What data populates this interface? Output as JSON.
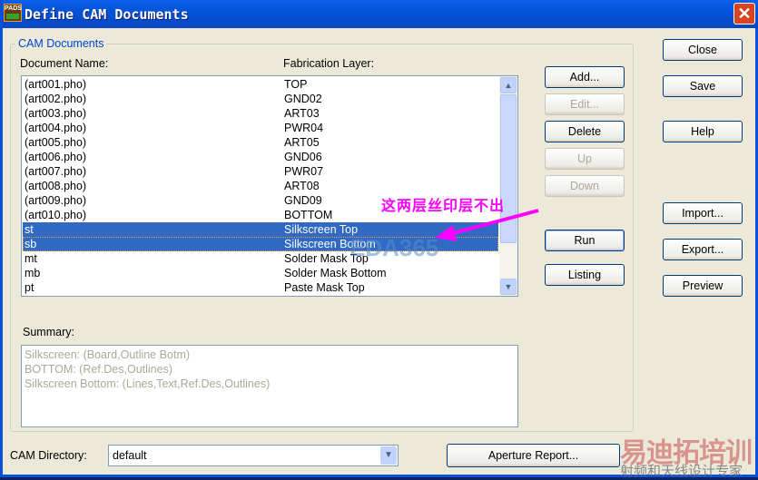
{
  "window": {
    "title": "Define CAM Documents",
    "icon_text": "PADS"
  },
  "group": {
    "label": "CAM Documents"
  },
  "columns": {
    "document_name": "Document Name:",
    "fabrication_layer": "Fabrication Layer:"
  },
  "rows": [
    {
      "doc": "(art001.pho)",
      "layer": "TOP"
    },
    {
      "doc": "(art002.pho)",
      "layer": "GND02"
    },
    {
      "doc": "(art003.pho)",
      "layer": "ART03"
    },
    {
      "doc": "(art004.pho)",
      "layer": "PWR04"
    },
    {
      "doc": "(art005.pho)",
      "layer": "ART05"
    },
    {
      "doc": "(art006.pho)",
      "layer": "GND06"
    },
    {
      "doc": "(art007.pho)",
      "layer": "PWR07"
    },
    {
      "doc": "(art008.pho)",
      "layer": "ART08"
    },
    {
      "doc": "(art009.pho)",
      "layer": "GND09"
    },
    {
      "doc": "(art010.pho)",
      "layer": "BOTTOM"
    },
    {
      "doc": "st",
      "layer": "Silkscreen Top",
      "selected": true
    },
    {
      "doc": "sb",
      "layer": "Silkscreen Bottom",
      "selected": true
    },
    {
      "doc": "mt",
      "layer": "Solder Mask Top"
    },
    {
      "doc": "mb",
      "layer": "Solder Mask Bottom"
    },
    {
      "doc": "pt",
      "layer": "Paste Mask Top"
    }
  ],
  "buttons": {
    "add": "Add...",
    "edit": "Edit...",
    "delete": "Delete",
    "up": "Up",
    "down": "Down",
    "run": "Run",
    "listing": "Listing",
    "close": "Close",
    "save": "Save",
    "help": "Help",
    "import": "Import...",
    "export": "Export...",
    "preview": "Preview",
    "aperture_report": "Aperture Report..."
  },
  "summary": {
    "label": "Summary:",
    "lines": [
      "Silkscreen: (Board,Outline Botm)",
      "BOTTOM: (Ref.Des,Outlines)",
      "Silkscreen Bottom: (Lines,Text,Ref.Des,Outlines)"
    ]
  },
  "cam_directory": {
    "label": "CAM Directory:",
    "value": "default"
  },
  "annotation": {
    "text": "这两层丝印层不出",
    "color": "#FF00FF"
  },
  "watermarks": {
    "eda": "EDA365",
    "brand": "易迪拓培训",
    "slogan": "射频和天线设计专家"
  }
}
